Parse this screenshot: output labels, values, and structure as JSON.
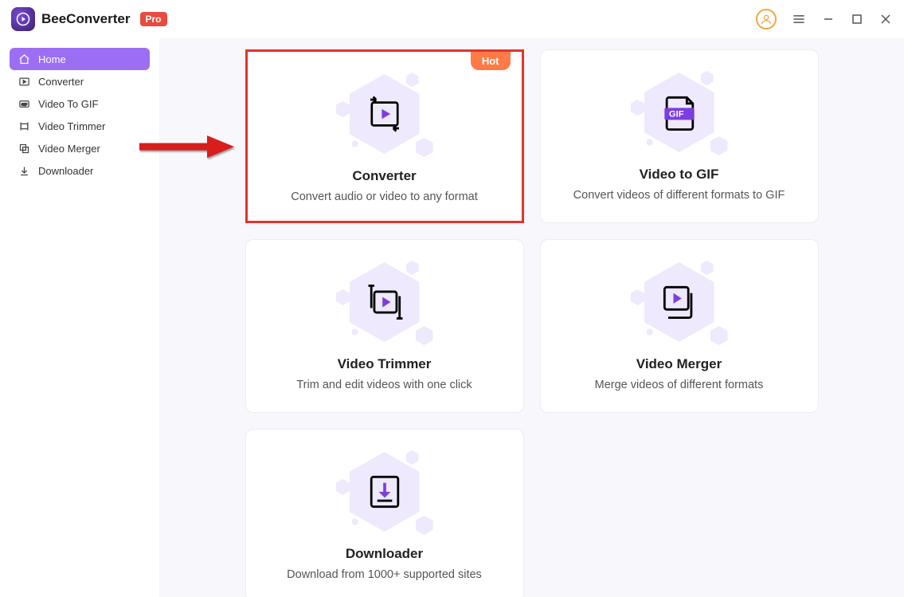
{
  "app": {
    "name": "BeeConverter",
    "badge": "Pro"
  },
  "sidebar": {
    "items": [
      {
        "label": "Home",
        "icon": "home",
        "active": true
      },
      {
        "label": "Converter",
        "icon": "convert",
        "active": false
      },
      {
        "label": "Video To GIF",
        "icon": "gif",
        "active": false
      },
      {
        "label": "Video Trimmer",
        "icon": "trim",
        "active": false
      },
      {
        "label": "Video Merger",
        "icon": "merge",
        "active": false
      },
      {
        "label": "Downloader",
        "icon": "download",
        "active": false
      }
    ]
  },
  "cards": [
    {
      "title": "Converter",
      "desc": "Convert audio or video to any format",
      "hot": "Hot",
      "highlight": true
    },
    {
      "title": "Video to GIF",
      "desc": "Convert videos of different formats to GIF"
    },
    {
      "title": "Video Trimmer",
      "desc": "Trim and edit videos with one click"
    },
    {
      "title": "Video Merger",
      "desc": "Merge videos of different formats"
    },
    {
      "title": "Downloader",
      "desc": "Download from 1000+ supported sites"
    }
  ],
  "colors": {
    "accent": "#9b6ef3",
    "hot": "#ff7a47",
    "highlight": "#e2332e",
    "iconPurple": "#7a3fe0",
    "iconFill": "#9b6ef3"
  }
}
